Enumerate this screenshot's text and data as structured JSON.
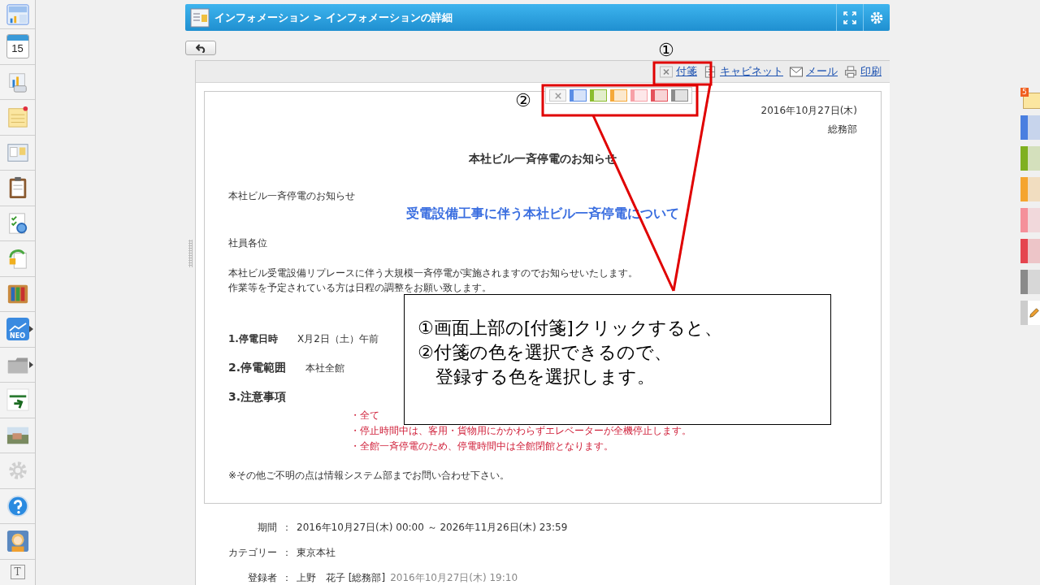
{
  "sidebar": {
    "items": [
      {
        "kind": "dashboard"
      },
      {
        "kind": "calendar",
        "label": "15"
      },
      {
        "kind": "chart"
      },
      {
        "kind": "memo"
      },
      {
        "kind": "board"
      },
      {
        "kind": "clipboard"
      },
      {
        "kind": "checklist"
      },
      {
        "kind": "refresh"
      },
      {
        "kind": "binders"
      },
      {
        "kind": "neo",
        "label": "NEO",
        "submenu": true
      },
      {
        "kind": "folder",
        "submenu": true
      },
      {
        "kind": "logo"
      },
      {
        "kind": "photo"
      },
      {
        "kind": "gear",
        "disabled": true
      },
      {
        "kind": "help"
      },
      {
        "kind": "support"
      },
      {
        "kind": "text",
        "label": "T"
      }
    ]
  },
  "header": {
    "breadcrumb": "インフォメーション > インフォメーションの詳細"
  },
  "toolbar": {
    "actions": [
      {
        "kind": "sticky",
        "label": "付箋"
      },
      {
        "kind": "cabinet",
        "label": "キャビネット"
      },
      {
        "kind": "mail",
        "label": "メール"
      },
      {
        "kind": "print",
        "label": "印刷"
      }
    ]
  },
  "sticky_palette": [
    {
      "kind": "clear"
    },
    {
      "kind": "swatch",
      "color": "#5b8ee6"
    },
    {
      "kind": "swatch",
      "color": "#8bbd2e"
    },
    {
      "kind": "swatch",
      "color": "#f5a93a"
    },
    {
      "kind": "swatch",
      "color": "#f7a1a8"
    },
    {
      "kind": "swatch",
      "color": "#e5525c"
    },
    {
      "kind": "swatch",
      "color": "#8c8c8c"
    }
  ],
  "document": {
    "date": "2016年10月27日(木)",
    "department": "総務部",
    "title": "本社ビル一斉停電のお知らせ",
    "subject": "本社ビル一斉停電のお知らせ",
    "headline": "受電設備工事に伴う本社ビル一斉停電について",
    "greeting": "社員各位",
    "body": [
      "本社ビル受電設備リプレースに伴う大規模一斉停電が実施されますのでお知らせいたします。",
      "作業等を予定されている方は日程の調整をお願い致します。"
    ],
    "sections": [
      {
        "kind": "small",
        "label": "1.停電日時",
        "value": "X月2日（土）午前"
      },
      {
        "kind": "large",
        "label": "2.停電範囲",
        "value": "本社全館"
      },
      {
        "kind": "large",
        "label": "3.注意事項"
      }
    ],
    "notes": [
      "・全て",
      "・停止時間中は、客用・貨物用にかかわらずエレベーターが全機停止します。",
      "・全館一斉停電のため、停電時間中は全館閉館となります。"
    ],
    "footer": "※その他ご不明の点は情報システム部までお問い合わせ下さい。"
  },
  "meta": [
    {
      "label": "期間",
      "separator": "：",
      "value": "2016年10月27日(木) 00:00 ～ 2026年11月26日(木) 23:59"
    },
    {
      "label": "カテゴリー",
      "separator": "：",
      "value": "東京本社"
    },
    {
      "label": "登録者",
      "separator": "：",
      "value": "上野　花子 [総務部]",
      "extra": "2016年10月27日(木) 19:10"
    }
  ],
  "right_tabs": {
    "badge": "5",
    "colors": [
      {
        "color": "#4a7fe0"
      },
      {
        "color": "#7fb020"
      },
      {
        "color": "#f5a530"
      },
      {
        "color": "#f5909a"
      },
      {
        "color": "#e5454f"
      },
      {
        "color": "#8a8a8a"
      }
    ]
  },
  "annotation": {
    "markers": [
      "①",
      "②"
    ],
    "callout": [
      "①画面上部の[付箋]クリックすると、",
      "②付箋の色を選択できるので、",
      "　登録する色を選択します。"
    ]
  }
}
